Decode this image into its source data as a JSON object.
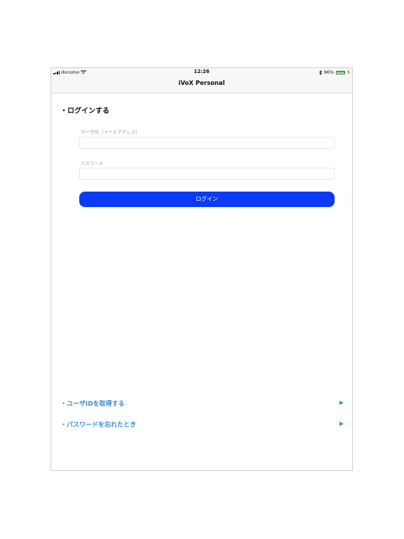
{
  "status_bar": {
    "carrier": "docomo",
    "time": "12:26",
    "battery_text": "96%",
    "battery_level": 0.96,
    "bluetooth_icon": "bluetooth-icon",
    "wifi_icon": "wifi-icon"
  },
  "nav": {
    "title": "iVoX Personal"
  },
  "login": {
    "section_title": "・ログインする",
    "user_id_label": "ユーザID（メールアドレス）",
    "user_id_value": "",
    "password_label": "パスワード",
    "password_value": "",
    "button_label": "ログイン",
    "button_color": "#0a3af5"
  },
  "links": [
    {
      "label": "・ユーザIDを取得する",
      "arrow": "▶"
    },
    {
      "label": "・パスワードを忘れたとき",
      "arrow": "▶"
    }
  ],
  "colors": {
    "link": "#3b8fd6",
    "battery": "#4cd964"
  }
}
